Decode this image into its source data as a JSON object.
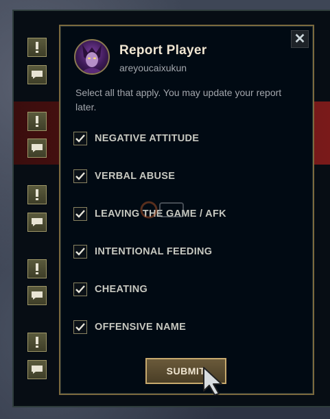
{
  "dialog": {
    "title": "Report Player",
    "username": "areyoucaixukun",
    "instructions": "Select all that apply. You may update your report later.",
    "close_label": "✕",
    "submit_label": "SUBMIT"
  },
  "options": [
    {
      "label": "NEGATIVE ATTITUDE",
      "checked": true
    },
    {
      "label": "VERBAL ABUSE",
      "checked": true
    },
    {
      "label": "LEAVING THE GAME / AFK",
      "checked": true
    },
    {
      "label": "INTENTIONAL FEEDING",
      "checked": true
    },
    {
      "label": "CHEATING",
      "checked": true
    },
    {
      "label": "OFFENSIVE NAME",
      "checked": true
    }
  ],
  "side_buttons": [
    {
      "icon": "exclamation-icon"
    },
    {
      "icon": "chat-icon"
    },
    {
      "icon": "exclamation-icon"
    },
    {
      "icon": "chat-icon"
    },
    {
      "icon": "exclamation-icon"
    },
    {
      "icon": "chat-icon"
    },
    {
      "icon": "exclamation-icon"
    },
    {
      "icon": "chat-icon"
    },
    {
      "icon": "exclamation-icon"
    },
    {
      "icon": "chat-icon"
    }
  ],
  "colors": {
    "gold_border": "#7c6a3e",
    "modal_bg": "#010a13",
    "title": "#f0e6d2",
    "muted_text": "#a3a7ad",
    "highlight_row": "#5a1414"
  }
}
